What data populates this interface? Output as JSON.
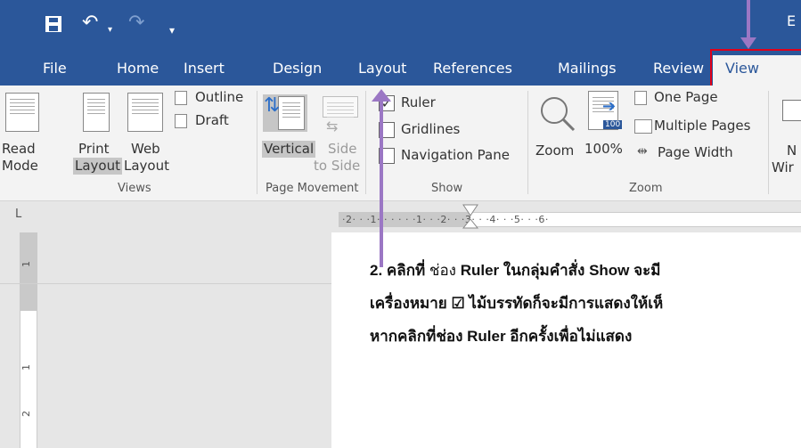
{
  "quick_access": {
    "save_icon": "save-icon",
    "undo_icon": "undo-icon",
    "undo_arrow": "▾",
    "redo_icon": "redo-icon",
    "customize": "▾",
    "title_fragment": "E"
  },
  "tabs": [
    "File",
    "Home",
    "Insert",
    "Design",
    "Layout",
    "References",
    "Mailings",
    "Review",
    "View"
  ],
  "active_tab": "View",
  "ribbon": {
    "views": {
      "read_mode": [
        "Read",
        "Mode"
      ],
      "print_layout": [
        "Print",
        "Layout"
      ],
      "web_layout": [
        "Web",
        "Layout"
      ],
      "outline": "Outline",
      "draft": "Draft",
      "group": "Views"
    },
    "page_movement": {
      "vertical": "Vertical",
      "side_to_side": [
        "Side",
        "to Side"
      ],
      "group": "Page Movement"
    },
    "show": {
      "ruler": "Ruler",
      "ruler_checked": "✓",
      "gridlines": "Gridlines",
      "navigation_pane": "Navigation Pane",
      "group": "Show"
    },
    "zoom": {
      "zoom": "Zoom",
      "hundred": "100%",
      "hundred_badge": "100",
      "one_page": "One Page",
      "multiple_pages": "Multiple Pages",
      "page_width": "Page Width",
      "group": "Zoom"
    },
    "window": {
      "new": [
        "N",
        "Wir"
      ]
    }
  },
  "ruler": {
    "tab_selector": "L",
    "horizontal_ticks": "·2· · ·1· · ·   · · ·1· · ·2· · ·3· · ·4· · ·5· · ·6·",
    "vertical_labels": [
      "1",
      "1",
      "2"
    ]
  },
  "annotation": {
    "line1_prefix": "2. คลิกที่ ",
    "line1_normal": "ช่อง ",
    "line1_ruler": "Ruler",
    "line1_mid": " ในกลุ่มคำสั่ง ",
    "line1_show": "Show",
    "line1_end": " จะมี",
    "line2": "เครื่องหมาย ☑ ไม้บรรทัดก็จะมีการแสดงให้เห็",
    "line3_a": "หากคลิกที่ช่อง ",
    "line3_ruler": "Ruler",
    "line3_b": " อีกครั้งเพื่อไม่แสดง"
  },
  "colors": {
    "title_bar": "#2b579a",
    "highlight": "#e0001a",
    "arrow": "#9b77c4"
  }
}
